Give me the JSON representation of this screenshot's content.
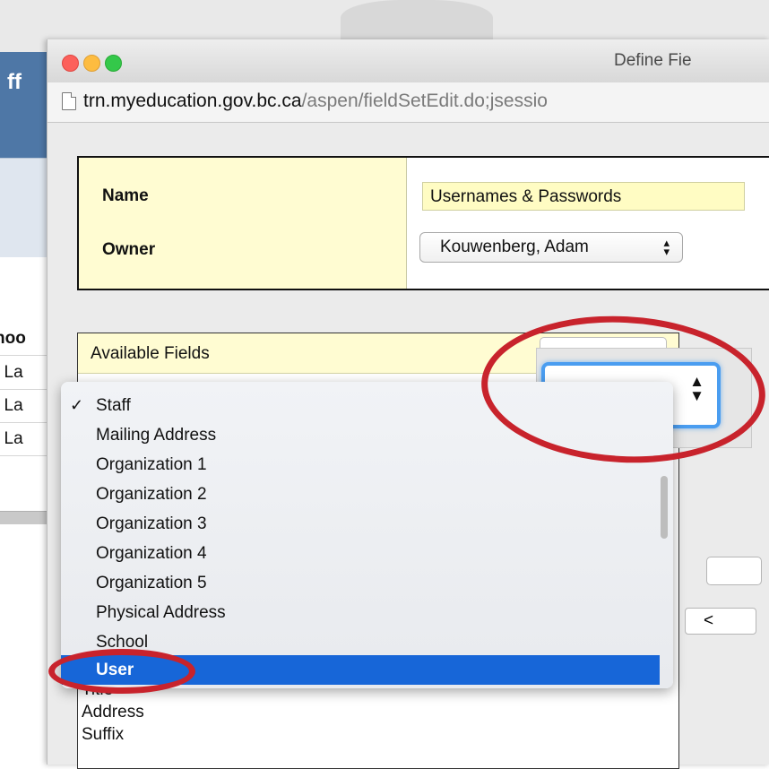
{
  "background": {
    "header_fragment": "ff",
    "table_header_fragment": "hoo",
    "row_fragments": [
      "ı La",
      "ı La",
      "ı La"
    ]
  },
  "window": {
    "title": "Define Fie",
    "url_domain": "trn.myeducation.gov.bc.ca",
    "url_path": "/aspen/fieldSetEdit.do;jsessio"
  },
  "form": {
    "name_label": "Name",
    "name_value": "Usernames & Passwords",
    "owner_label": "Owner",
    "owner_value": "Kouwenberg, Adam",
    "owner_arrows": "▴▾"
  },
  "fields": {
    "title": "Available Fields",
    "dropdown_options": [
      {
        "label": "Staff",
        "checked": true,
        "highlighted": false
      },
      {
        "label": "Mailing Address",
        "checked": false,
        "highlighted": false
      },
      {
        "label": "Organization 1",
        "checked": false,
        "highlighted": false
      },
      {
        "label": "Organization 2",
        "checked": false,
        "highlighted": false
      },
      {
        "label": "Organization 3",
        "checked": false,
        "highlighted": false
      },
      {
        "label": "Organization 4",
        "checked": false,
        "highlighted": false
      },
      {
        "label": "Organization 5",
        "checked": false,
        "highlighted": false
      },
      {
        "label": "Physical Address",
        "checked": false,
        "highlighted": false
      },
      {
        "label": "School",
        "checked": false,
        "highlighted": false
      },
      {
        "label": "User",
        "checked": false,
        "highlighted": true
      }
    ],
    "check_mark": "✓",
    "list_items_below": [
      "Title",
      "Address",
      "Suffix"
    ],
    "select_arrows": "▲▼"
  },
  "right_controls": {
    "move_left_label": "<"
  },
  "colors": {
    "annotation_red": "#c8232c",
    "highlight_blue": "#1766d8",
    "label_yellow": "#fffcd2"
  }
}
